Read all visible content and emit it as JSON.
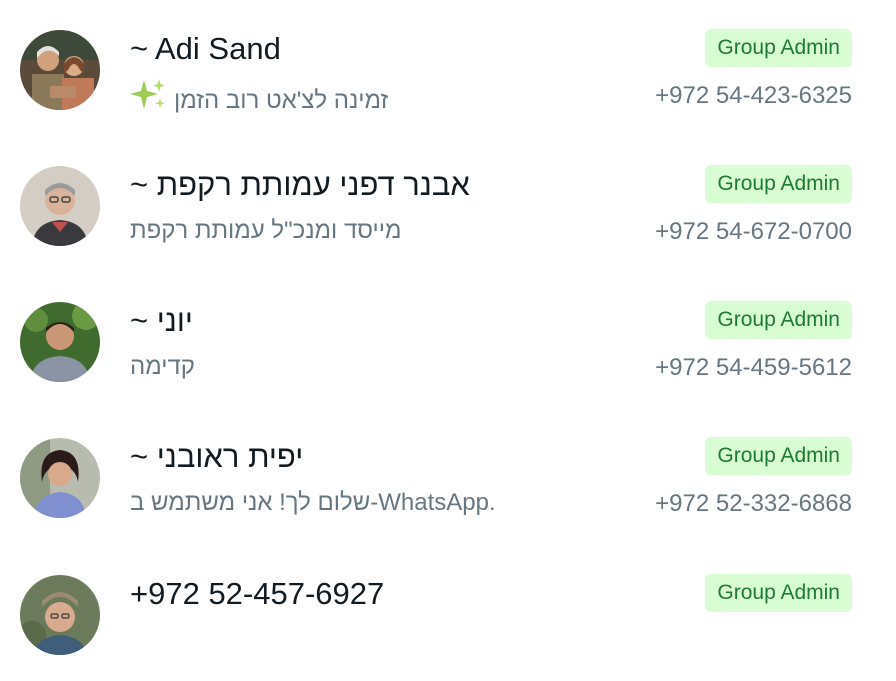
{
  "members": [
    {
      "name": "~ Adi Sand",
      "about": "זמינה לצ'אט רוב הזמן",
      "about_icon": "sparkles-icon",
      "phone": "+972 54-423-6325",
      "badge": "Group Admin"
    },
    {
      "name": "~ אבנר דפני עמותת רקפת",
      "about": "מייסד ומנכ\"ל עמותת רקפת",
      "phone": "+972 54-672-0700",
      "badge": "Group Admin"
    },
    {
      "name": "~ יוני",
      "about": "קדימה",
      "phone": "+972 54-459-5612",
      "badge": "Group Admin"
    },
    {
      "name": "~ יפית ראובני",
      "about": "שלום לך! אני משתמש ב-WhatsApp.",
      "phone": "+972 52-332-6868",
      "badge": "Group Admin"
    },
    {
      "name": "+972 52-457-6927",
      "badge": "Group Admin"
    }
  ],
  "colors": {
    "badge_bg": "#d9fdd3",
    "badge_text": "#1d7b35",
    "primary_text": "#111b21",
    "secondary_text": "#667781"
  }
}
